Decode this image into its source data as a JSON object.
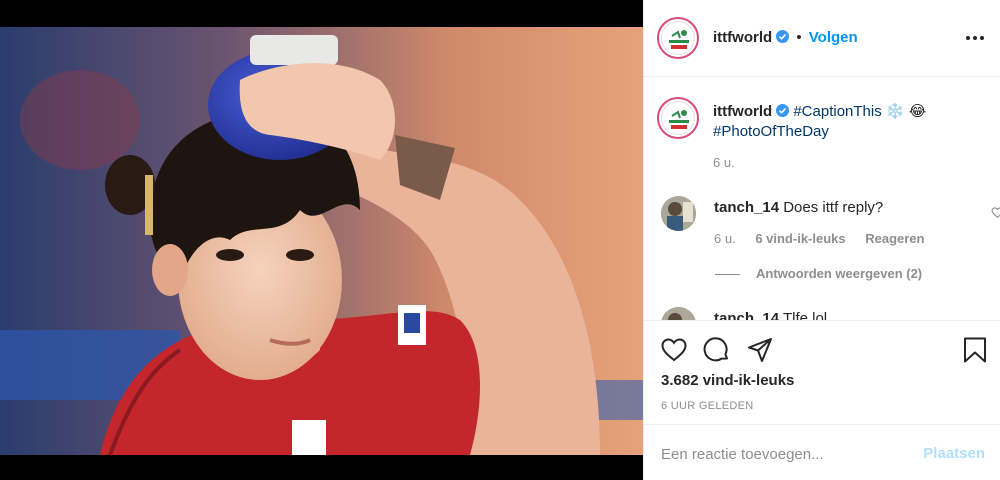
{
  "post": {
    "photo_alt": "Table tennis player with ice pack on head",
    "header": {
      "username": "ittfworld",
      "separator": "•",
      "follow_label": "Volgen"
    },
    "caption": {
      "username": "ittfworld",
      "hashtag1": "#CaptionThis",
      "emojis": "❄️ 😂",
      "hashtag2": "#PhotoOfTheDay",
      "time": "6 u."
    },
    "comments": [
      {
        "username": "tanch_14",
        "text": "Does ittf reply?",
        "time": "6 u.",
        "likes": "6 vind-ik-leuks",
        "reply_label": "Reageren",
        "view_replies": "Antwoorden weergeven (2)"
      },
      {
        "username": "tanch_14",
        "text": "Tlfe lol"
      }
    ],
    "likes_count": "3.682 vind-ik-leuks",
    "post_time": "6 UUR GELEDEN",
    "add_comment": {
      "placeholder": "Een reactie toevoegen...",
      "post_label": "Plaatsen"
    }
  },
  "colors": {
    "accent": "#0095f6",
    "hashtag": "#00376b",
    "muted": "#8e8e8e",
    "post_disabled": "#b2dffc"
  },
  "icons": [
    "more-icon",
    "verified-icon",
    "heart-icon",
    "comment-icon",
    "share-icon",
    "bookmark-icon"
  ]
}
